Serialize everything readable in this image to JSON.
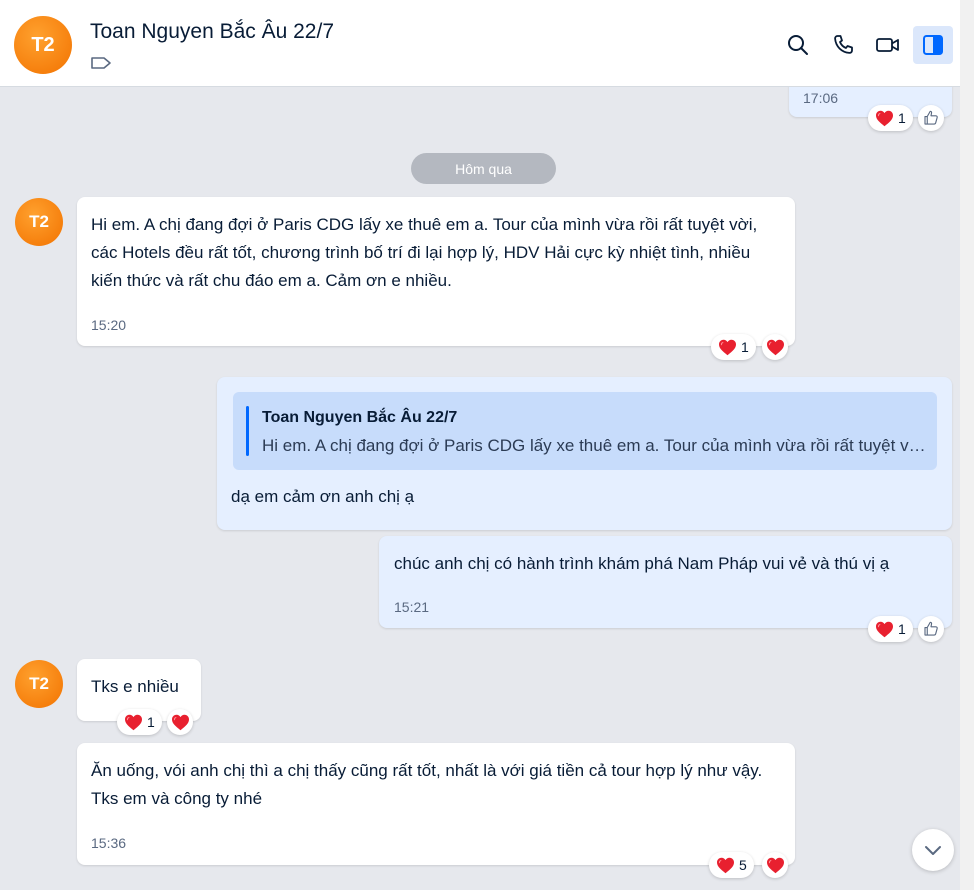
{
  "header": {
    "avatar_initials": "T2",
    "title": "Toan Nguyen Bắc Âu 22/7",
    "icons": [
      "tag-icon",
      "search-icon",
      "phone-icon",
      "video-icon",
      "sidebar-toggle-icon"
    ]
  },
  "prev_message": {
    "time": "17:06",
    "reaction_count": "1"
  },
  "date_divider": "Hôm qua",
  "messages": [
    {
      "avatar": "T2",
      "text": "Hi em. A chị đang đợi ở Paris CDG lấy xe thuê em a. Tour của mình vừa rồi rất tuyệt vời, các Hotels đều rất tốt, chương trình bố trí đi lại hợp lý, HDV Hải cực kỳ nhiệt tình, nhiều kiến thức và rất chu đáo em a. Cảm ơn e nhiều.",
      "time": "15:20",
      "reaction_count": "1"
    },
    {
      "quote_author": "Toan Nguyen Bắc Âu 22/7",
      "quote_text": "Hi em. A chị đang đợi ở Paris CDG lấy xe thuê em a. Tour của mình vừa rồi rất tuyệt vời, các Hotels đều rất tốt, chương trình bố trí đi lại hợp lý, HDV Hải cực kỳ nhiệt tình, nhiều kiến thức và rất chu đáo em a. Cảm ơn e nhiều.",
      "text": "dạ em cảm ơn anh chị ạ"
    },
    {
      "text": "chúc anh chị có hành trình khám phá Nam Pháp vui vẻ và thú vị ạ",
      "time": "15:21",
      "reaction_count": "1"
    },
    {
      "avatar": "T2",
      "text": "Tks e nhiều",
      "reaction_count": "1"
    },
    {
      "text": "Ăn uống, vói anh chị thì a chị thấy cũng rất tốt, nhất là với giá tiền cả tour hợp lý như vậy.  Tks em và công ty nhé",
      "time": "15:36",
      "reaction_count": "5"
    }
  ],
  "colors": {
    "accent": "#0068ff",
    "outgoing_bubble": "#e5efff",
    "avatar": "#f27200",
    "background": "#e6e8ed"
  }
}
